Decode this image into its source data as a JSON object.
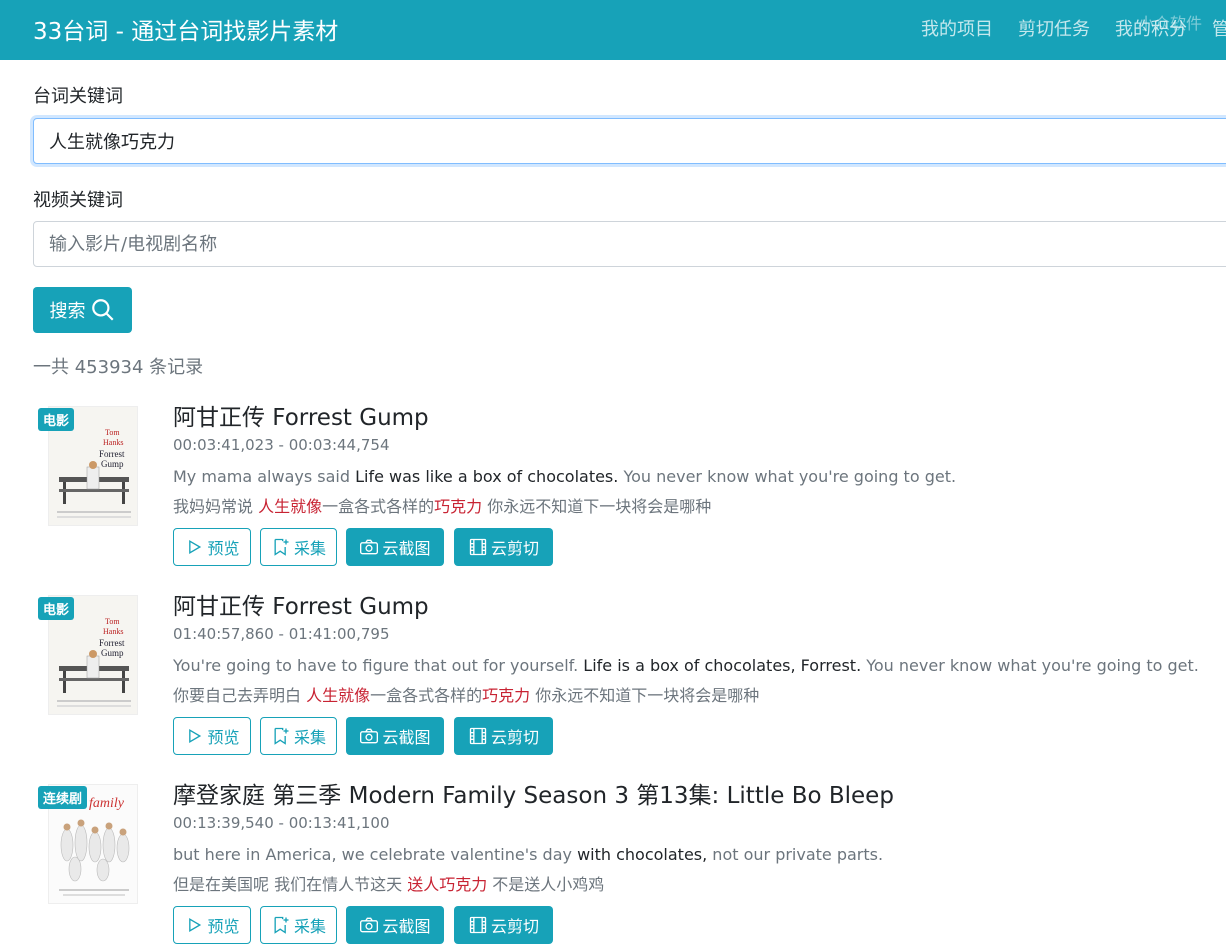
{
  "app": {
    "title": "33台词 - 通过台词找影片素材",
    "nav": [
      "我的项目",
      "剪切任务",
      "我的积分",
      "管"
    ],
    "watermark": "小众软件"
  },
  "search": {
    "line_label": "台词关键词",
    "line_value": "人生就像巧克力",
    "video_label": "视频关键词",
    "video_placeholder": "输入影片/电视剧名称",
    "button_label": "搜索"
  },
  "record_count": "一共 453934 条记录",
  "actions": {
    "preview": "预览",
    "collect": "采集",
    "screenshot": "云截图",
    "clip": "云剪切"
  },
  "results": [
    {
      "badge": "电影",
      "title": "阿甘正传 Forrest Gump",
      "time": "00:03:41,023 - 00:03:44,754",
      "en_pre": "My mama always said ",
      "en_hl": "Life was like a box of chocolates.",
      "en_post": " You never know what you're going to get.",
      "zh_pre": "我妈妈常说 ",
      "zh_hl1": "人生就像",
      "zh_mid": "一盒各式各样的",
      "zh_hl2": "巧克力",
      "zh_post": " 你永远不知道下一块将会是哪种",
      "poster_text": "Tom Hanks is Forrest Gump"
    },
    {
      "badge": "电影",
      "title": "阿甘正传 Forrest Gump",
      "time": "01:40:57,860 - 01:41:00,795",
      "en_pre": "You're going to have to figure that out for yourself. ",
      "en_hl": "Life is a box of chocolates, Forrest.",
      "en_post": " You never know what you're going to get.",
      "zh_pre": "你要自己去弄明白 ",
      "zh_hl1": "人生就像",
      "zh_mid": "一盒各式各样的",
      "zh_hl2": "巧克力",
      "zh_post": " 你永远不知道下一块将会是哪种",
      "poster_text": "Tom Hanks is Forrest Gump"
    },
    {
      "badge": "连续剧",
      "title": "摩登家庭 第三季 Modern Family Season 3 第13集: Little Bo Bleep",
      "time": "00:13:39,540 - 00:13:41,100",
      "en_pre": "but here in America, we celebrate valentine's day ",
      "en_hl": "with chocolates,",
      "en_post": " not our private parts.",
      "zh_pre": "但是在美国呢 我们在情人节这天 ",
      "zh_hl1": "送人",
      "zh_mid": "",
      "zh_hl2": "巧克力",
      "zh_post": " 不是送人小鸡鸡",
      "poster_text": "family"
    }
  ],
  "colors": {
    "accent": "#17a2b8",
    "highlight_zh": "#c82333",
    "muted": "#6c757d"
  }
}
